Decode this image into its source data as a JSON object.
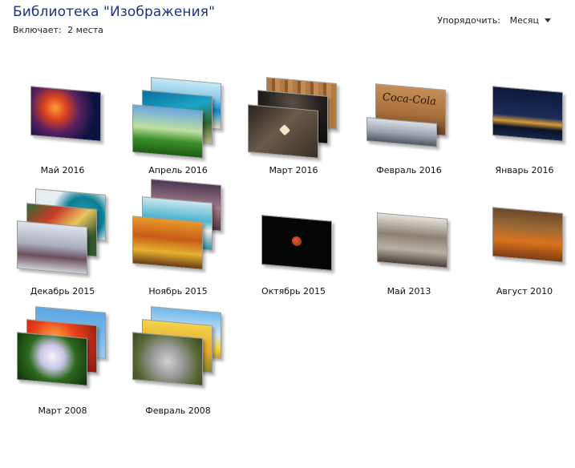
{
  "header": {
    "title": "Библиотека \"Изображения\"",
    "includes_label": "Включает:",
    "includes_value": "2 места",
    "arrange_label": "Упорядочить:",
    "arrange_value": "Месяц"
  },
  "groups": [
    {
      "label": "Май 2016"
    },
    {
      "label": "Апрель 2016"
    },
    {
      "label": "Март 2016"
    },
    {
      "label": "Февраль 2016"
    },
    {
      "label": "Январь 2016"
    },
    {
      "label": "Декабрь 2015"
    },
    {
      "label": "Ноябрь 2015"
    },
    {
      "label": "Октябрь 2015"
    },
    {
      "label": "Май 2013"
    },
    {
      "label": "Август 2010"
    },
    {
      "label": "Март 2008"
    },
    {
      "label": "Февраль 2008"
    }
  ],
  "thumbnail_text": {
    "coca_cola": "Coca-Cola"
  }
}
